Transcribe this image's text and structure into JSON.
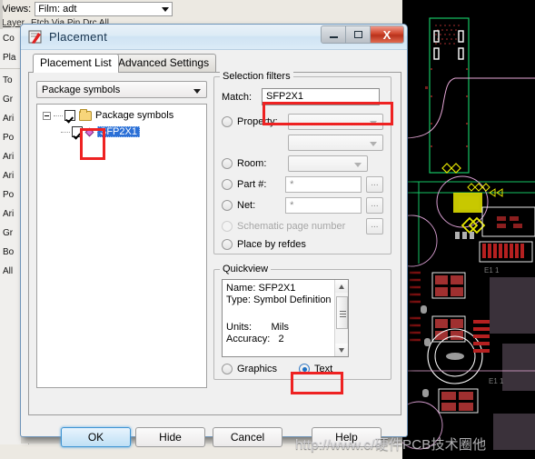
{
  "background_app": {
    "views_label": "Views:",
    "views_value": "Film: adt",
    "layer_label": "Layer",
    "layer_flags": "Etch Via Pin Drc All",
    "side_items": [
      "Co",
      "Pla",
      "To",
      "Gr",
      "Ari",
      "Po",
      "Ari",
      "Ari",
      "Po",
      "Ari",
      "Gr",
      "Bo",
      "All"
    ]
  },
  "dialog": {
    "title": "Placement",
    "icon": "placement-icon",
    "window_buttons": {
      "minimize": "minimize-icon",
      "maximize": "maximize-icon",
      "close": "X"
    },
    "tabs": [
      {
        "label": "Placement List",
        "active": true
      },
      {
        "label": "Advanced Settings",
        "active": false
      }
    ],
    "left_panel": {
      "type_combo_value": "Package symbols",
      "tree": {
        "root_label": "Package symbols",
        "root_checked": true,
        "children": [
          {
            "label": "SFP2X1",
            "checked": true,
            "selected": true
          }
        ]
      }
    },
    "selection_filters": {
      "group_title": "Selection filters",
      "match_label": "Match:",
      "match_value": "SFP2X1",
      "property_label": "Property:",
      "property_value": "",
      "property_value2": "",
      "room_label": "Room:",
      "room_value": "",
      "part_label": "Part #:",
      "part_value": "*",
      "net_label": "Net:",
      "net_value": "*",
      "schematic_label": "Schematic page number",
      "place_by_refdes_label": "Place by refdes",
      "browse_label": "...",
      "selected_radio": "none"
    },
    "quickview": {
      "group_title": "Quickview",
      "lines": [
        "Name: SFP2X1",
        "Type: Symbol Definition",
        "",
        "Units:       Mils",
        "Accuracy:   2"
      ],
      "mode_graphics_label": "Graphics",
      "mode_text_label": "Text",
      "mode_selected": "Text"
    },
    "buttons": [
      {
        "label": "OK",
        "default": true
      },
      {
        "label": "Hide",
        "default": false
      },
      {
        "label": "Cancel",
        "default": false
      },
      {
        "label": "Help",
        "default": false
      }
    ]
  },
  "annotations": {
    "highlight_color": "#ee2222",
    "boxes": [
      "tree-checkbox-highlight",
      "match-field-highlight",
      "text-radio-highlight"
    ]
  },
  "watermark": {
    "text": "http://www.c/硬件PCB技术圈他"
  }
}
